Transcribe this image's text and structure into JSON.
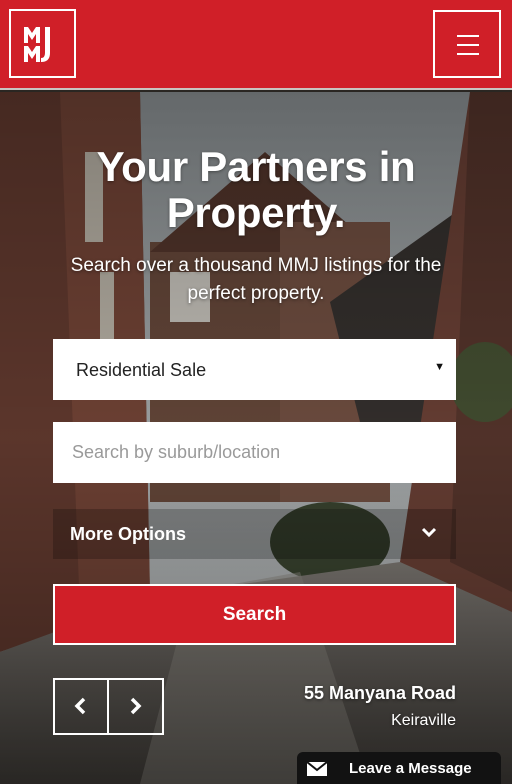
{
  "header": {
    "logo_text": "MMJ",
    "menu_icon": "hamburger-icon",
    "brand_color": "#d01f28"
  },
  "hero": {
    "title_line1": "Your Partners in",
    "title_line2": "Property.",
    "subtitle": "Search over a thousand MMJ listings for the perfect property."
  },
  "search": {
    "type_value": "Residential Sale",
    "location_placeholder": "Search by suburb/location",
    "more_options_label": "More Options",
    "button_label": "Search"
  },
  "carousel": {
    "prev_icon": "chevron-left-icon",
    "next_icon": "chevron-right-icon",
    "property_address": "55 Manyana Road",
    "property_suburb": "Keiraville"
  },
  "chat": {
    "icon": "envelope-icon",
    "label": "Leave a Message"
  }
}
